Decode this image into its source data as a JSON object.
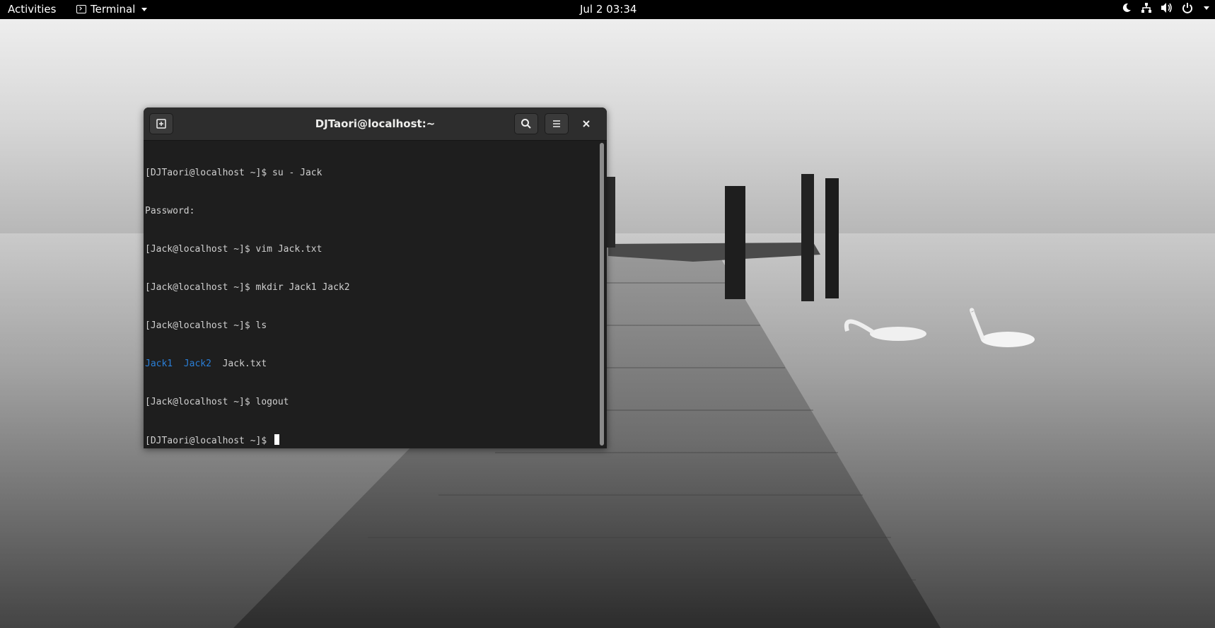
{
  "topbar": {
    "activities": "Activities",
    "app_name": "Terminal",
    "clock": "Jul 2  03:34",
    "status_icons": [
      "night-light-icon",
      "network-icon",
      "volume-icon",
      "power-icon",
      "chevron-down-icon"
    ]
  },
  "terminal": {
    "title": "DJTaori@localhost:~",
    "buttons": {
      "new_tab": "new-tab-icon",
      "search": "search-icon",
      "menu": "hamburger-menu-icon",
      "close": "close-icon"
    },
    "lines": [
      "[DJTaori@localhost ~]$ su - Jack",
      "Password:",
      "[Jack@localhost ~]$ vim Jack.txt",
      "[Jack@localhost ~]$ mkdir Jack1 Jack2",
      "[Jack@localhost ~]$ ls"
    ],
    "ls_output": {
      "dir1": "Jack1",
      "dir2": "Jack2",
      "file1": "Jack.txt"
    },
    "after_lines": [
      "[Jack@localhost ~]$ logout"
    ],
    "prompt": "[DJTaori@localhost ~]$ "
  },
  "colors": {
    "directory": "#2a7fd8",
    "terminal_bg": "#1e1e1e",
    "headerbar_bg": "#2d2d2d"
  }
}
